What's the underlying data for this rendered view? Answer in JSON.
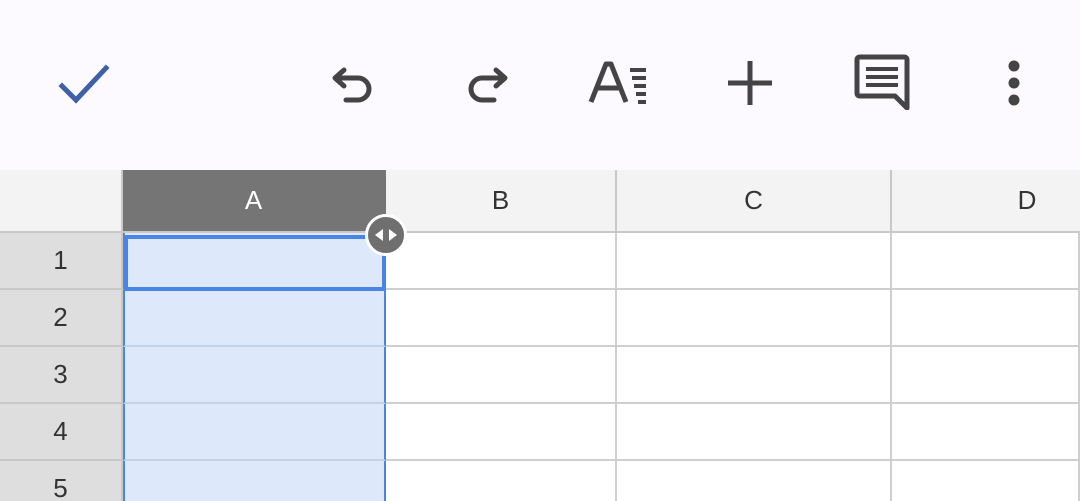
{
  "toolbar": {
    "buttons": [
      {
        "name": "done-button",
        "icon": "check-icon"
      },
      {
        "name": "undo-button",
        "icon": "undo-icon"
      },
      {
        "name": "redo-button",
        "icon": "redo-icon"
      },
      {
        "name": "text-format-button",
        "icon": "text-format-icon"
      },
      {
        "name": "insert-button",
        "icon": "plus-icon"
      },
      {
        "name": "comment-button",
        "icon": "comment-icon"
      },
      {
        "name": "more-options-button",
        "icon": "more-vert-icon"
      }
    ],
    "background": "#fcf9ff",
    "check_color": "#3f5fa8",
    "icon_color": "#444444"
  },
  "sheet": {
    "columns": [
      "A",
      "B",
      "C",
      "D"
    ],
    "rows": [
      "1",
      "2",
      "3",
      "4",
      "5"
    ],
    "selected_column": "A",
    "active_cell": "A1",
    "selection_color": "#4a85e6",
    "selection_fill": "#dde9fb"
  }
}
